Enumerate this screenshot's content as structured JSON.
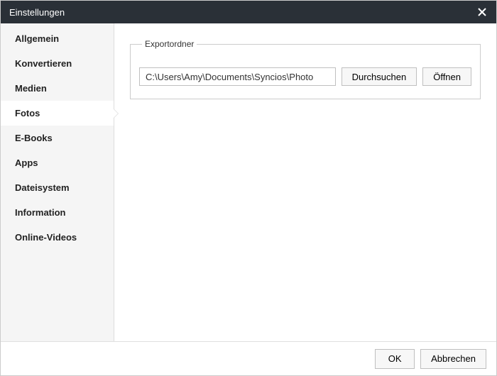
{
  "window": {
    "title": "Einstellungen"
  },
  "sidebar": {
    "items": [
      {
        "label": "Allgemein"
      },
      {
        "label": "Konvertieren"
      },
      {
        "label": "Medien"
      },
      {
        "label": "Fotos"
      },
      {
        "label": "E-Books"
      },
      {
        "label": "Apps"
      },
      {
        "label": "Dateisystem"
      },
      {
        "label": "Information"
      },
      {
        "label": "Online-Videos"
      }
    ],
    "activeIndex": 3
  },
  "content": {
    "exportFolder": {
      "legend": "Exportordner",
      "path": "C:\\Users\\Amy\\Documents\\Syncios\\Photo",
      "browse_label": "Durchsuchen",
      "open_label": "Öffnen"
    }
  },
  "footer": {
    "ok_label": "OK",
    "cancel_label": "Abbrechen"
  }
}
